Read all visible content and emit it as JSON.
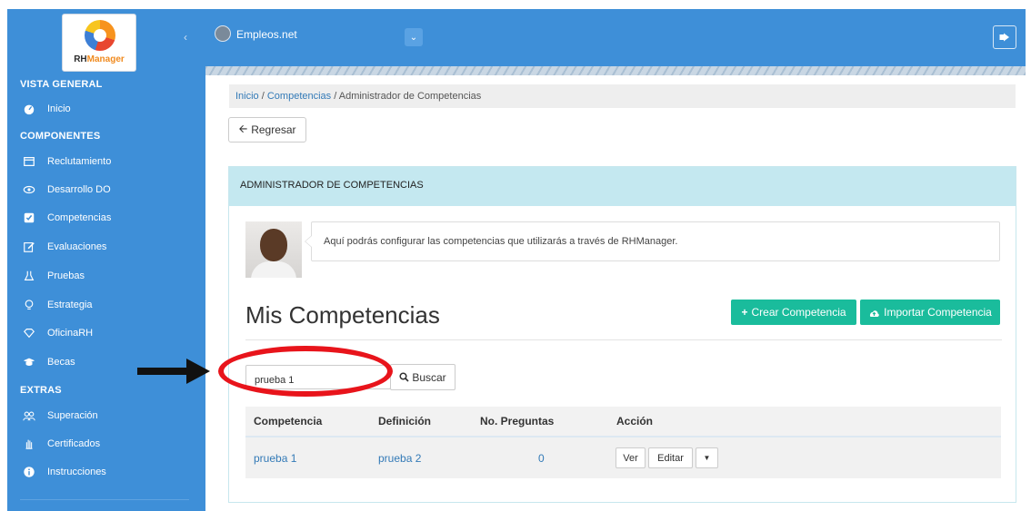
{
  "brand": {
    "logo_text_a": "RH",
    "logo_text_b": "Manager"
  },
  "sidebar": {
    "sections": [
      {
        "label": "VISTA GENERAL"
      },
      {
        "label": "COMPONENTES"
      },
      {
        "label": "EXTRAS"
      }
    ],
    "items": [
      {
        "label": "Inicio",
        "icon": "dashboard-icon"
      },
      {
        "label": "Reclutamiento",
        "icon": "window-icon"
      },
      {
        "label": "Desarrollo DO",
        "icon": "eye-icon"
      },
      {
        "label": "Competencias",
        "icon": "checkbox-icon"
      },
      {
        "label": "Evaluaciones",
        "icon": "edit-icon"
      },
      {
        "label": "Pruebas",
        "icon": "flask-icon"
      },
      {
        "label": "Estrategia",
        "icon": "lightbulb-icon"
      },
      {
        "label": "OficinaRH",
        "icon": "diamond-icon"
      },
      {
        "label": "Becas",
        "icon": "graduation-cap-icon"
      },
      {
        "label": "Superación",
        "icon": "users-icon"
      },
      {
        "label": "Certificados",
        "icon": "hand-icon"
      },
      {
        "label": "Instrucciones",
        "icon": "info-icon"
      }
    ]
  },
  "topbar": {
    "company_name": "Empleos.net"
  },
  "breadcrumb": {
    "home": "Inicio",
    "section": "Competencias",
    "current": "Administrador de Competencias",
    "separator": " / "
  },
  "back_button": "Regresar",
  "panel": {
    "heading": "ADMINISTRADOR DE COMPETENCIAS",
    "info": "Aquí podrás configurar las competencias que utilizarás a través de RHManager.",
    "title": "Mis Competencias",
    "create_label": "Crear Competencia",
    "import_label": "Importar Competencia"
  },
  "search": {
    "value": "prueba 1",
    "button": "Buscar"
  },
  "table": {
    "headers": [
      "Competencia",
      "Definición",
      "No. Preguntas",
      "Acción"
    ],
    "rows": [
      {
        "competencia": "prueba 1",
        "definicion": "prueba 2",
        "preguntas": "0",
        "ver": "Ver",
        "editar": "Editar"
      }
    ]
  },
  "colors": {
    "primary": "#3e8fd8",
    "success": "#1abc9c",
    "panel_heading": "#c4e8f0",
    "annotation": "#e8141b"
  }
}
